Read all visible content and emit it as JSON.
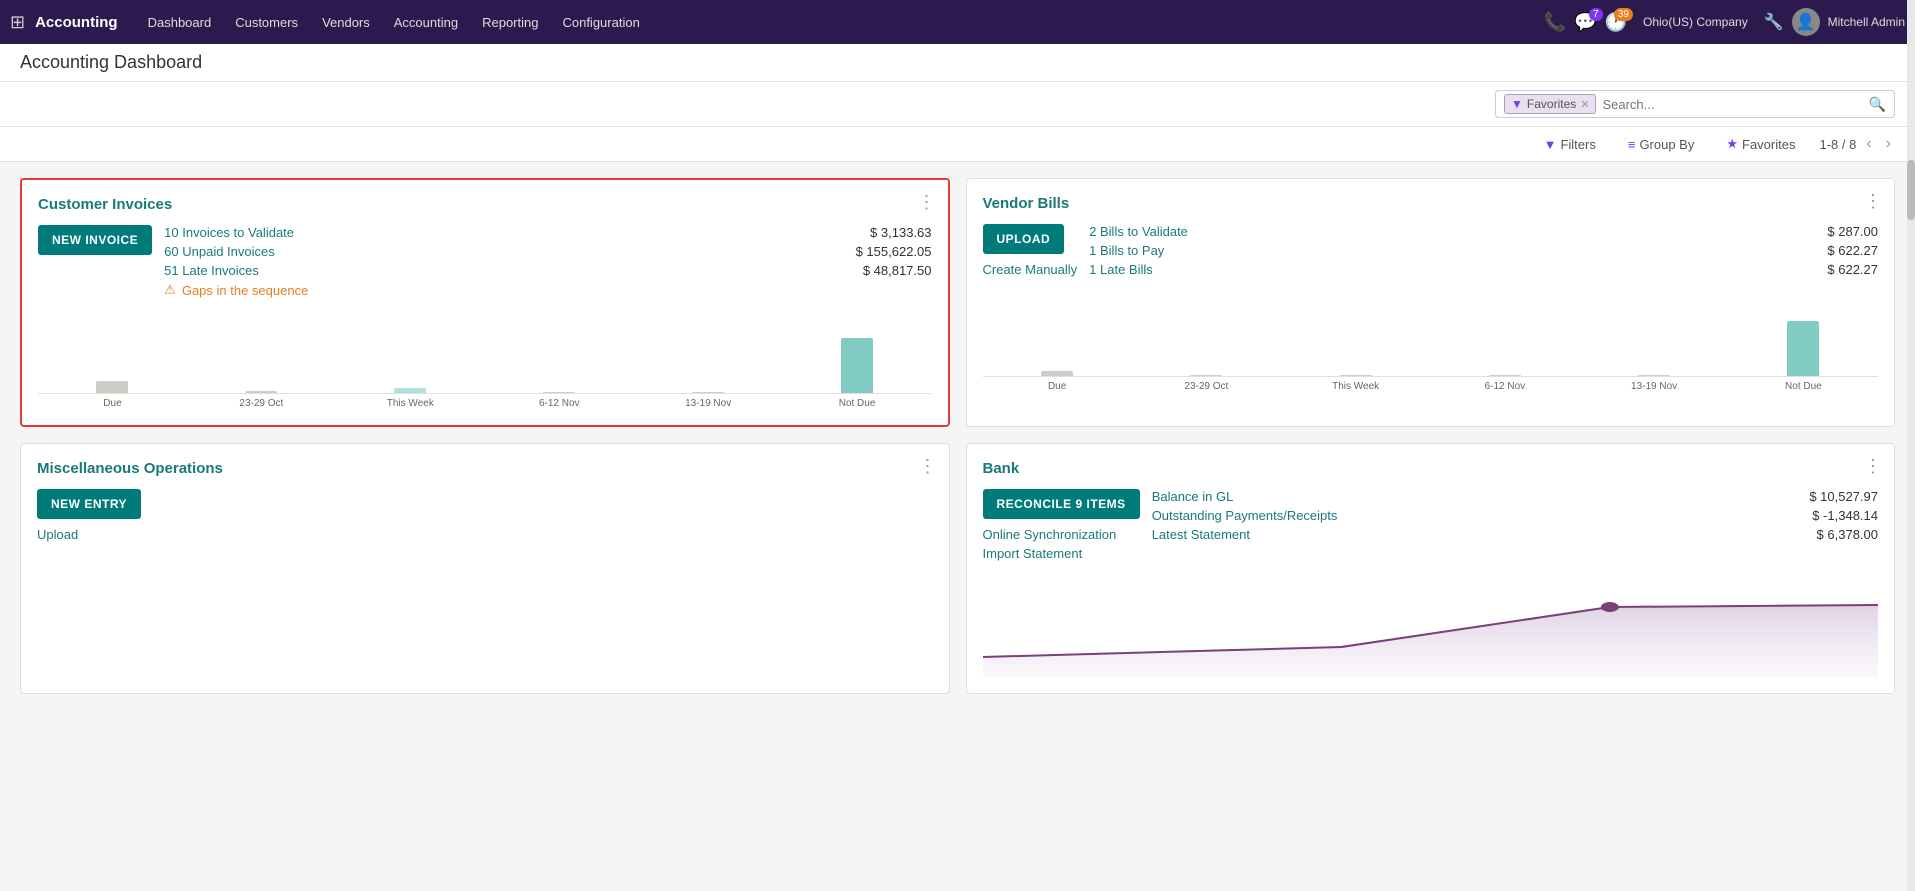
{
  "app": {
    "brand": "Accounting",
    "nav_items": [
      "Dashboard",
      "Customers",
      "Vendors",
      "Accounting",
      "Reporting",
      "Configuration"
    ],
    "company": "Ohio(US) Company",
    "user": "Mitchell Admin",
    "badge_chat": "7",
    "badge_activity": "39"
  },
  "page": {
    "title": "Accounting Dashboard"
  },
  "search": {
    "favorites_tag": "Favorites",
    "placeholder": "Search...",
    "filters_label": "Filters",
    "group_by_label": "Group By",
    "favorites_label": "Favorites",
    "pagination": "1-8 / 8"
  },
  "customer_invoices": {
    "title": "Customer Invoices",
    "new_invoice_btn": "NEW INVOICE",
    "stats": [
      {
        "label": "10 Invoices to Validate",
        "value": "$ 3,133.63"
      },
      {
        "label": "60 Unpaid Invoices",
        "value": "$ 155,622.05"
      },
      {
        "label": "51 Late Invoices",
        "value": "$ 48,817.50"
      }
    ],
    "warning": "Gaps in the sequence",
    "chart_labels": [
      "Due",
      "23-29 Oct",
      "This Week",
      "6-12 Nov",
      "13-19 Nov",
      "Not Due"
    ],
    "chart_bars": [
      12,
      0,
      3,
      0,
      0,
      55
    ]
  },
  "vendor_bills": {
    "title": "Vendor Bills",
    "upload_btn": "UPLOAD",
    "create_link": "Create Manually",
    "stats": [
      {
        "label": "2 Bills to Validate",
        "value": "$ 287.00"
      },
      {
        "label": "1 Bills to Pay",
        "value": "$ 622.27"
      },
      {
        "label": "1 Late Bills",
        "value": "$ 622.27"
      }
    ],
    "chart_labels": [
      "Due",
      "23-29 Oct",
      "This Week",
      "6-12 Nov",
      "13-19 Nov",
      "Not Due"
    ],
    "chart_bars": [
      4,
      0,
      0,
      0,
      0,
      55
    ]
  },
  "misc_operations": {
    "title": "Miscellaneous Operations",
    "new_entry_btn": "NEW ENTRY",
    "upload_link": "Upload"
  },
  "bank": {
    "title": "Bank",
    "reconcile_btn": "RECONCILE 9 ITEMS",
    "online_sync_link": "Online Synchronization",
    "import_link": "Import Statement",
    "stats": [
      {
        "label": "Balance in GL",
        "value": "$ 10,527.97"
      },
      {
        "label": "Outstanding Payments/Receipts",
        "value": "$ -1,348.14"
      },
      {
        "label": "Latest Statement",
        "value": "$ 6,378.00"
      }
    ]
  }
}
